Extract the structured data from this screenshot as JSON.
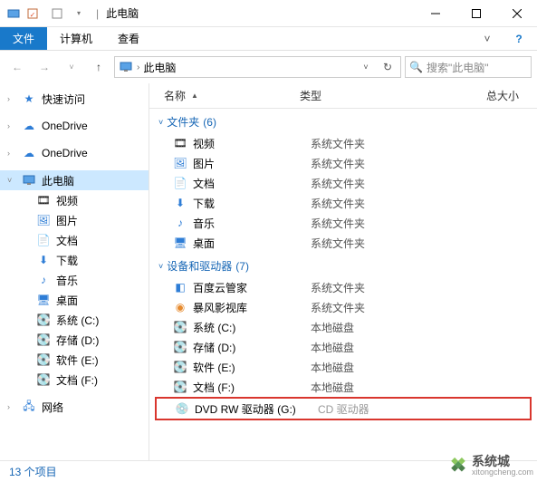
{
  "titlebar": {
    "title": "此电脑"
  },
  "ribbon": {
    "file": "文件",
    "computer": "计算机",
    "view": "查看"
  },
  "addressbar": {
    "crumb": "此电脑",
    "search_placeholder": "搜索\"此电脑\""
  },
  "columns": {
    "name": "名称",
    "type": "类型",
    "size": "总大小"
  },
  "sidebar": {
    "quick_access": "快速访问",
    "onedrive1": "OneDrive",
    "onedrive2": "OneDrive",
    "this_pc": "此电脑",
    "videos": "视频",
    "pictures": "图片",
    "documents": "文档",
    "downloads": "下载",
    "music": "音乐",
    "desktop": "桌面",
    "drive_c": "系统 (C:)",
    "drive_d": "存储 (D:)",
    "drive_e": "软件 (E:)",
    "drive_f": "文档 (F:)",
    "network": "网络"
  },
  "groups": {
    "folders": {
      "label": "文件夹",
      "count": "(6)"
    },
    "devices": {
      "label": "设备和驱动器",
      "count": "(7)"
    }
  },
  "folder_items": [
    {
      "name": "视频",
      "type": "系统文件夹"
    },
    {
      "name": "图片",
      "type": "系统文件夹"
    },
    {
      "name": "文档",
      "type": "系统文件夹"
    },
    {
      "name": "下载",
      "type": "系统文件夹"
    },
    {
      "name": "音乐",
      "type": "系统文件夹"
    },
    {
      "name": "桌面",
      "type": "系统文件夹"
    }
  ],
  "device_items": [
    {
      "name": "百度云管家",
      "type": "系统文件夹"
    },
    {
      "name": "暴风影视库",
      "type": "系统文件夹"
    },
    {
      "name": "系统 (C:)",
      "type": "本地磁盘"
    },
    {
      "name": "存储 (D:)",
      "type": "本地磁盘"
    },
    {
      "name": "软件 (E:)",
      "type": "本地磁盘"
    },
    {
      "name": "文档 (F:)",
      "type": "本地磁盘"
    }
  ],
  "cd_drive": {
    "name": "DVD RW 驱动器 (G:)",
    "type": "CD 驱动器"
  },
  "statusbar": {
    "count": "13 个项目"
  },
  "watermark": {
    "brand": "系统城",
    "url": "xitongcheng.com"
  }
}
